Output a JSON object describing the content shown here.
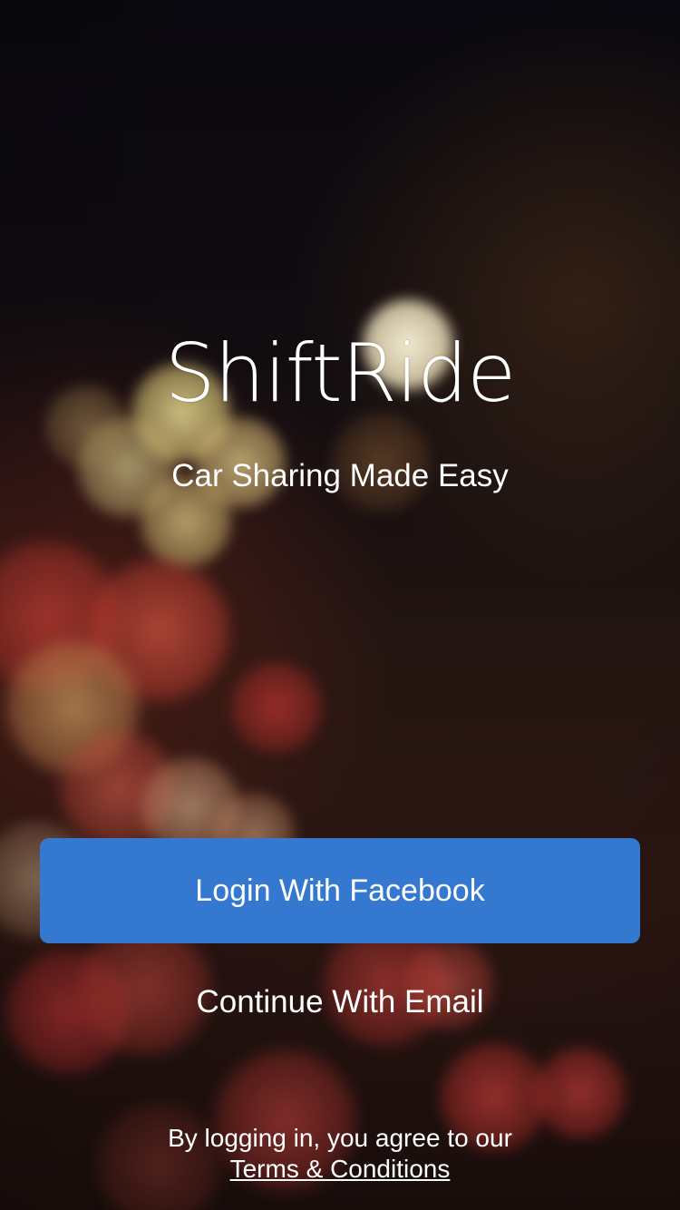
{
  "app": {
    "title": "ShiftRide",
    "tagline": "Car Sharing Made Easy"
  },
  "actions": {
    "facebook_label": "Login With Facebook",
    "email_label": "Continue With Email"
  },
  "legal": {
    "agreement_text": "By logging in, you agree to our",
    "terms_link": "Terms & Conditions"
  },
  "colors": {
    "facebook_button": "#3478d0",
    "text": "#ffffff",
    "background": "#0b0a10"
  },
  "background_image": "blurred-night-city-bokeh-lights"
}
